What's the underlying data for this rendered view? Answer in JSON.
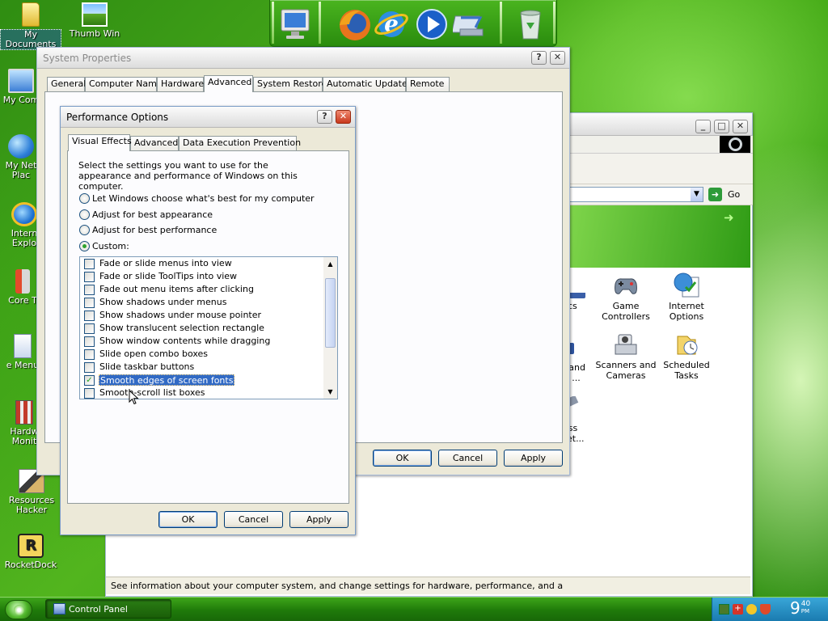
{
  "desktop": {
    "icons": [
      {
        "label": "My Documents",
        "icon": "folder-icon"
      },
      {
        "label": "Thumb Win",
        "icon": "photo-icon"
      },
      {
        "label": "My Com",
        "icon": "computer-icon"
      },
      {
        "label": "My Net",
        "label2": "Plac",
        "icon": "network-icon"
      },
      {
        "label": "Intern",
        "label2": "Explo",
        "icon": "internet-explorer-icon"
      },
      {
        "label": "Core T",
        "icon": "tool-icon"
      },
      {
        "label": "e Menu",
        "icon": "menu-icon"
      },
      {
        "label": "Hardw",
        "label2": "Monit",
        "icon": "hardware-monitor-icon"
      },
      {
        "label": "Resources",
        "label2": "Hacker",
        "icon": "resource-hacker-icon"
      },
      {
        "label": "RocketDock",
        "icon": "rocketdock-icon",
        "glyph_text": "R"
      }
    ]
  },
  "dock": {
    "items": [
      "monitor-icon",
      "firefox-icon",
      "internet-explorer-icon",
      "media-player-icon",
      "network-drive-icon",
      "recycle-bin-icon"
    ]
  },
  "system_properties": {
    "title": "System Properties",
    "tabs": [
      "General",
      "Computer Name",
      "Hardware",
      "Advanced",
      "System Restore",
      "Automatic Updates",
      "Remote"
    ],
    "active_tab": "Advanced",
    "buttons": {
      "ok": "OK",
      "cancel": "Cancel",
      "apply": "Apply"
    }
  },
  "control_panel": {
    "go_label": "Go",
    "items": [
      {
        "label": "Game",
        "label2": "Controllers",
        "icon": "game-controller-icon"
      },
      {
        "label": "Internet",
        "label2": "Options",
        "icon": "internet-options-icon"
      },
      {
        "label": "Scanners and",
        "label2": "Cameras",
        "icon": "scanner-camera-icon"
      },
      {
        "label": "Scheduled",
        "label2": "Tasks",
        "icon": "scheduled-tasks-icon"
      }
    ],
    "partial_labels": [
      "cs",
      "al and",
      "ge ...",
      "ess",
      "Set..."
    ],
    "status_text": "See information about your computer system, and change settings for hardware, performance, and automatic upda"
  },
  "performance_options": {
    "title": "Performance Options",
    "tabs": [
      "Visual Effects",
      "Advanced",
      "Data Execution Prevention"
    ],
    "active_tab": "Visual Effects",
    "description": "Select the settings you want to use for the appearance and performance of Windows on this computer.",
    "radios": [
      {
        "label": "Let Windows choose what's best for my computer",
        "checked": false
      },
      {
        "label": "Adjust for best appearance",
        "checked": false
      },
      {
        "label": "Adjust for best performance",
        "checked": false
      },
      {
        "label": "Custom:",
        "checked": true
      }
    ],
    "effects": [
      {
        "label": "Fade or slide menus into view",
        "checked": false
      },
      {
        "label": "Fade or slide ToolTips into view",
        "checked": false
      },
      {
        "label": "Fade out menu items after clicking",
        "checked": false
      },
      {
        "label": "Show shadows under menus",
        "checked": false
      },
      {
        "label": "Show shadows under mouse pointer",
        "checked": false
      },
      {
        "label": "Show translucent selection rectangle",
        "checked": false
      },
      {
        "label": "Show window contents while dragging",
        "checked": false
      },
      {
        "label": "Slide open combo boxes",
        "checked": false
      },
      {
        "label": "Slide taskbar buttons",
        "checked": false
      },
      {
        "label": "Smooth edges of screen fonts",
        "checked": true,
        "selected": true
      },
      {
        "label": "Smooth-scroll list boxes",
        "checked": false
      }
    ],
    "buttons": {
      "ok": "OK",
      "cancel": "Cancel",
      "apply": "Apply"
    }
  },
  "taskbar": {
    "task_label": "Control Panel",
    "clock": "9",
    "clock_minutes": "40",
    "clock_ampm": "PM"
  },
  "colors": {
    "selection": "#316ac5",
    "xp_button_border": "#003c74",
    "desktop_green": "#3ea515"
  }
}
